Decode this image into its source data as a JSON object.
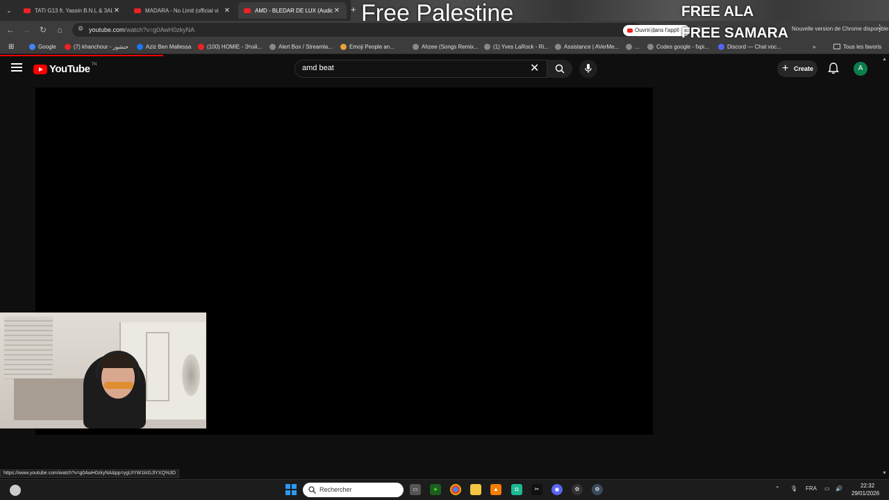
{
  "browser": {
    "tabs": [
      {
        "label": "TATI G13 ft. Yassin B.N.L & 3AL",
        "active": false
      },
      {
        "label": "MADARA - No Limit (official vi",
        "active": false
      },
      {
        "label": "AMD - BLEDAR DE LUX (Audio)",
        "active": true
      }
    ],
    "url_host": "youtube.com",
    "url_path": "/watch?v=g0AwH0zkyNA",
    "open_in_app_label": "Ouvrir dans l'appli",
    "update_notice": "Nouvelle version de Chrome disponible",
    "bookmarks": [
      {
        "label": "Google",
        "icon": "google-icon",
        "color": "#4285f4"
      },
      {
        "label": "(7) khanchour - خنشور",
        "icon": "youtube-icon",
        "color": "#e22"
      },
      {
        "label": "Aziz Ben Mallessa",
        "icon": "facebook-icon",
        "color": "#1877f2"
      },
      {
        "label": "(100) HOMIE - Этой...",
        "icon": "youtube-icon",
        "color": "#e22"
      },
      {
        "label": "Alert Box / Streamla...",
        "icon": "globe-icon",
        "color": "#888"
      },
      {
        "label": "Emoji People an...",
        "icon": "emoji-icon",
        "color": "#e8a23a"
      },
      {
        "label": "Ahzee (Songs Remix...",
        "icon": "globe-icon",
        "color": "#888"
      },
      {
        "label": "(1) Yves LaRock - Ri...",
        "icon": "globe-icon",
        "color": "#888"
      },
      {
        "label": "Assistance | AVerMe...",
        "icon": "globe-icon",
        "color": "#888"
      },
      {
        "label": "...",
        "icon": "globe-icon",
        "color": "#888"
      },
      {
        "label": "Codes google - fxpi...",
        "icon": "globe-icon",
        "color": "#888"
      },
      {
        "label": "Discord — Chat voc...",
        "icon": "discord-icon",
        "color": "#5865f2"
      }
    ],
    "all_bookmarks_label": "Tous les favoris",
    "status_url": "https://www.youtube.com/watch?v=g0AwH0zkyNA&pp=ygUIYW1kIGJlYXQ%3D"
  },
  "overlays": {
    "free_palestine": "Free Palestine",
    "free_ala": "FREE ALA",
    "free_samara": "FREE SAMARA"
  },
  "youtube": {
    "logo_text": "YouTube",
    "logo_tm": "TN",
    "search_value": "amd beat",
    "create_label": "Create",
    "avatar_letter": "A",
    "brand_red": "#ff0000"
  },
  "taskbar": {
    "search_placeholder": "Rechercher",
    "language": "FRA",
    "time": "22:32",
    "date": "29/01/2026",
    "apps": [
      "task-view-icon",
      "razer-icon",
      "chrome-icon",
      "file-explorer-icon",
      "vlc-icon",
      "app-icon",
      "capcut-icon",
      "discord-icon",
      "steelseries-icon",
      "settings-icon"
    ]
  }
}
